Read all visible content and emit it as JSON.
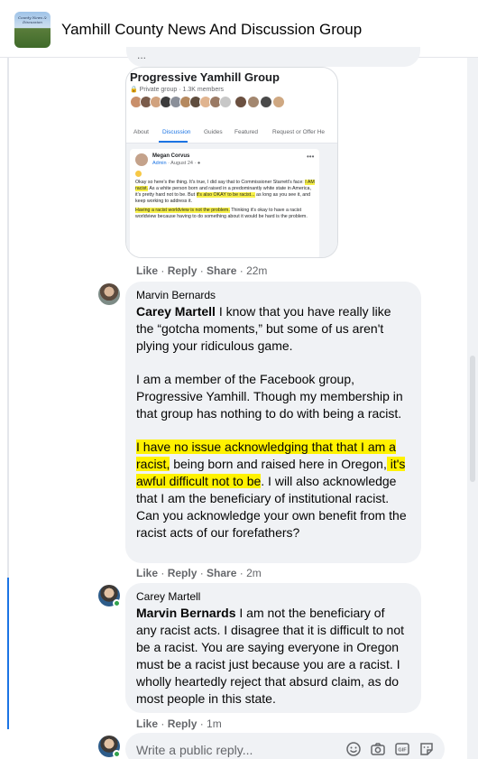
{
  "header": {
    "group_name": "Yamhill County News And Discussion Group",
    "thumb_text": "County News & Discussion"
  },
  "embed": {
    "group_title": "Progressive Yamhill Group",
    "group_meta": "Private group · 1.3K members",
    "tabs": [
      "About",
      "Discussion",
      "Guides",
      "Featured",
      "Request or Offer He"
    ],
    "active_tab": "Discussion",
    "post_author": "Megan Corvus",
    "post_role": "Admin",
    "post_date": " · August 24 · ",
    "post_p1_a": "Okay so here's the thing. It's true, I did say that to Commissioner Starrett's face: ",
    "post_p1_hl1": "I AM racist.",
    "post_p1_b": " As a white person born and raised in a predominantly white state in America, it's pretty hard not to be. But ",
    "post_p1_hl2": "it's also OKAY to be racist...",
    "post_p1_c": " as long as you see it, and keep working to address it.",
    "post_p2_hl": "Having a racist worldview is not the problem.",
    "post_p2_b": " Thinking it's okay to have a racist worldview because having to do something about it would be hard is the problem."
  },
  "embed_actions": {
    "like": "Like",
    "reply": "Reply",
    "share": "Share",
    "time": "22m"
  },
  "comment1": {
    "author": "Marvin Bernards",
    "mention": "Carey Martell",
    "p1_rest": " I know that you have really like the “gotcha moments,” but some of us aren't plying your ridiculous game.",
    "p2": "I am a member of the Facebook group, Progressive Yamhill. Though my membership in that group has nothing to do with being a racist.",
    "p3_hl1": "I have no issue acknowledging that that I am a racist,",
    "p3_mid": " being born and raised here in Oregon,",
    "p3_hl2": " it's awful difficult not to be",
    "p3_rest": ". I will also acknowledge that I am the beneficiary of institutional racist. Can you acknowledge your own benefit from the racist acts of our forefathers?"
  },
  "comment1_actions": {
    "like": "Like",
    "reply": "Reply",
    "share": "Share",
    "time": "2m"
  },
  "comment2": {
    "author": "Carey Martell",
    "mention": "Marvin Bernards",
    "text_rest": " I am not the beneficiary of any racist acts. I disagree that it is difficult to not be a racist. You are saying everyone in Oregon must be a racist just because you are a racist. I wholly heartedly reject that absurd claim, as do most people in this state."
  },
  "comment2_actions": {
    "like": "Like",
    "reply": "Reply",
    "time": "1m"
  },
  "reply_box": {
    "placeholder": "Write a public reply...",
    "icons": [
      "emoji-icon",
      "camera-icon",
      "gif-icon",
      "sticker-icon"
    ]
  },
  "colors": {
    "accent": "#1b74e4",
    "highlight": "#fff200",
    "online": "#31a24c",
    "bubble": "#f0f2f5"
  }
}
